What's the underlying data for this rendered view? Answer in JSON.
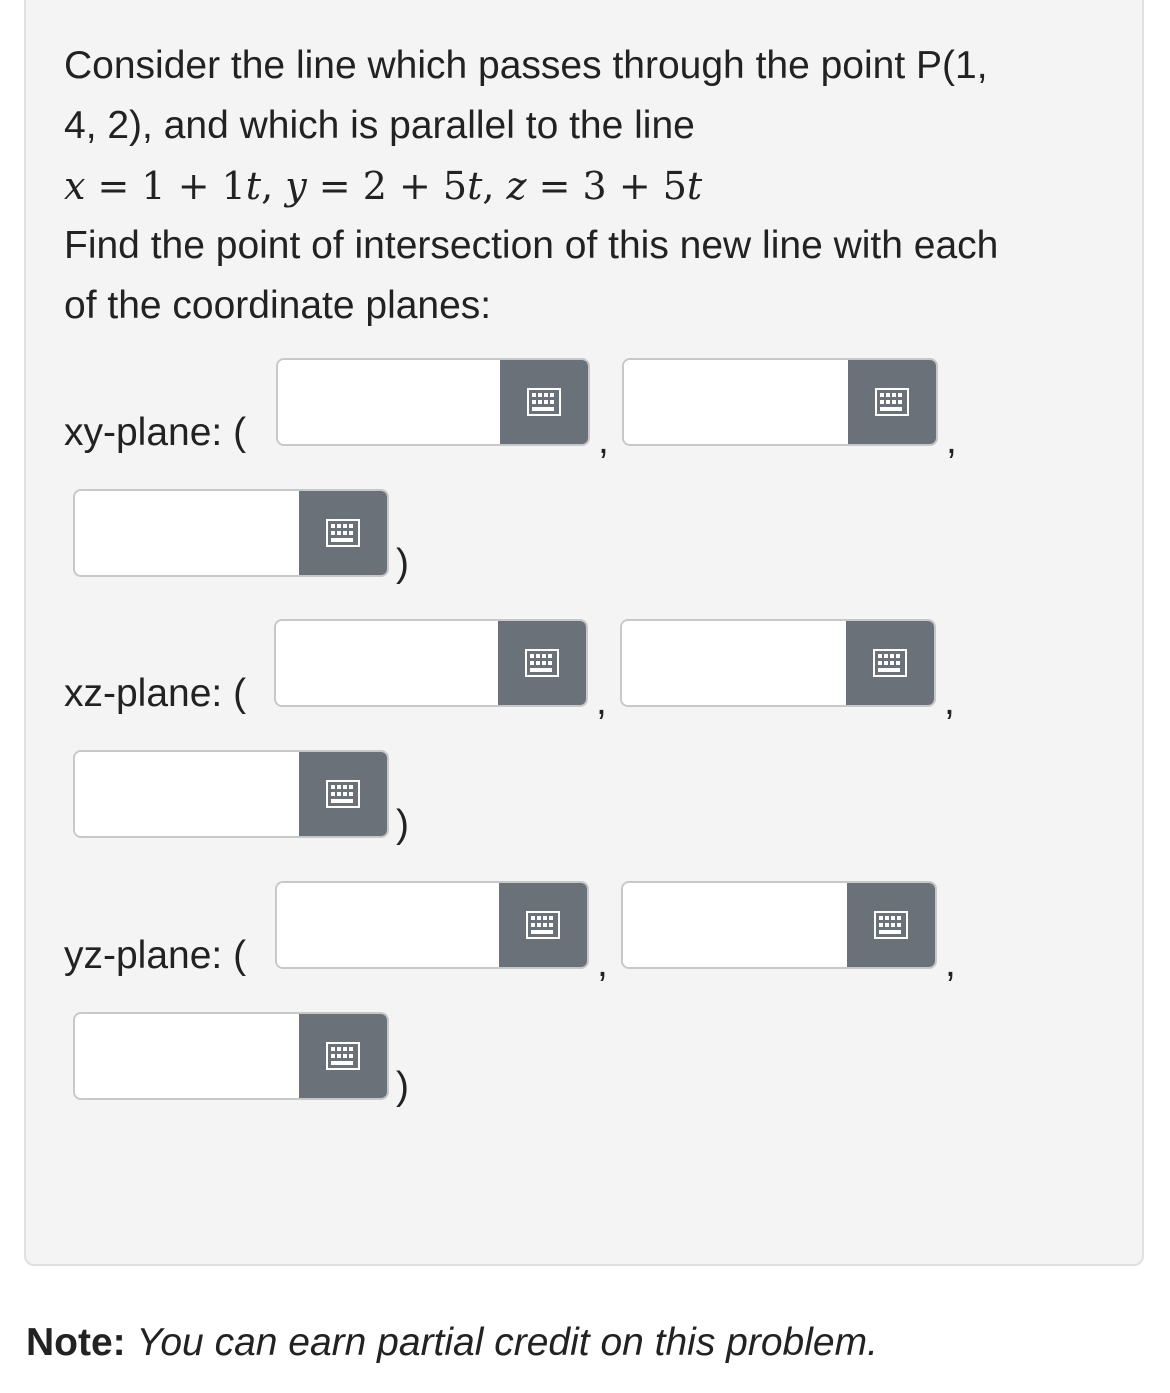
{
  "problem": {
    "intro_line1": "Consider the line which passes through the point P(1,",
    "intro_line2": "4, 2), and which is parallel to the line",
    "equation": {
      "x_var": "x",
      "x_expr": " = 1 + 1",
      "t1": "t",
      "comma_y": ", ",
      "y_var": "y",
      "y_expr": " = 2 + 5",
      "t2": "t",
      "comma_z": ", ",
      "z_var": "z",
      "z_expr": " = 3 + 5",
      "t3": "t"
    },
    "question_line1": "Find the point of intersection of this new line with each",
    "question_line2": "of the coordinate planes:"
  },
  "planes": [
    {
      "label": "xy-plane: (",
      "x_value": "",
      "y_value": "",
      "z_value": ""
    },
    {
      "label": "xz-plane: (",
      "x_value": "",
      "y_value": "",
      "z_value": ""
    },
    {
      "label": "yz-plane: (",
      "x_value": "",
      "y_value": "",
      "z_value": ""
    }
  ],
  "separators": {
    "comma": ",",
    "close_paren": ")"
  },
  "icons": {
    "palette": "equation-palette-icon"
  },
  "note": {
    "label": "Note:",
    "text": "You can earn partial credit on this problem."
  },
  "colors": {
    "panel_bg": "#f4f4f4",
    "palette_button": "#6b7178",
    "input_border": "#c8c8c8"
  }
}
